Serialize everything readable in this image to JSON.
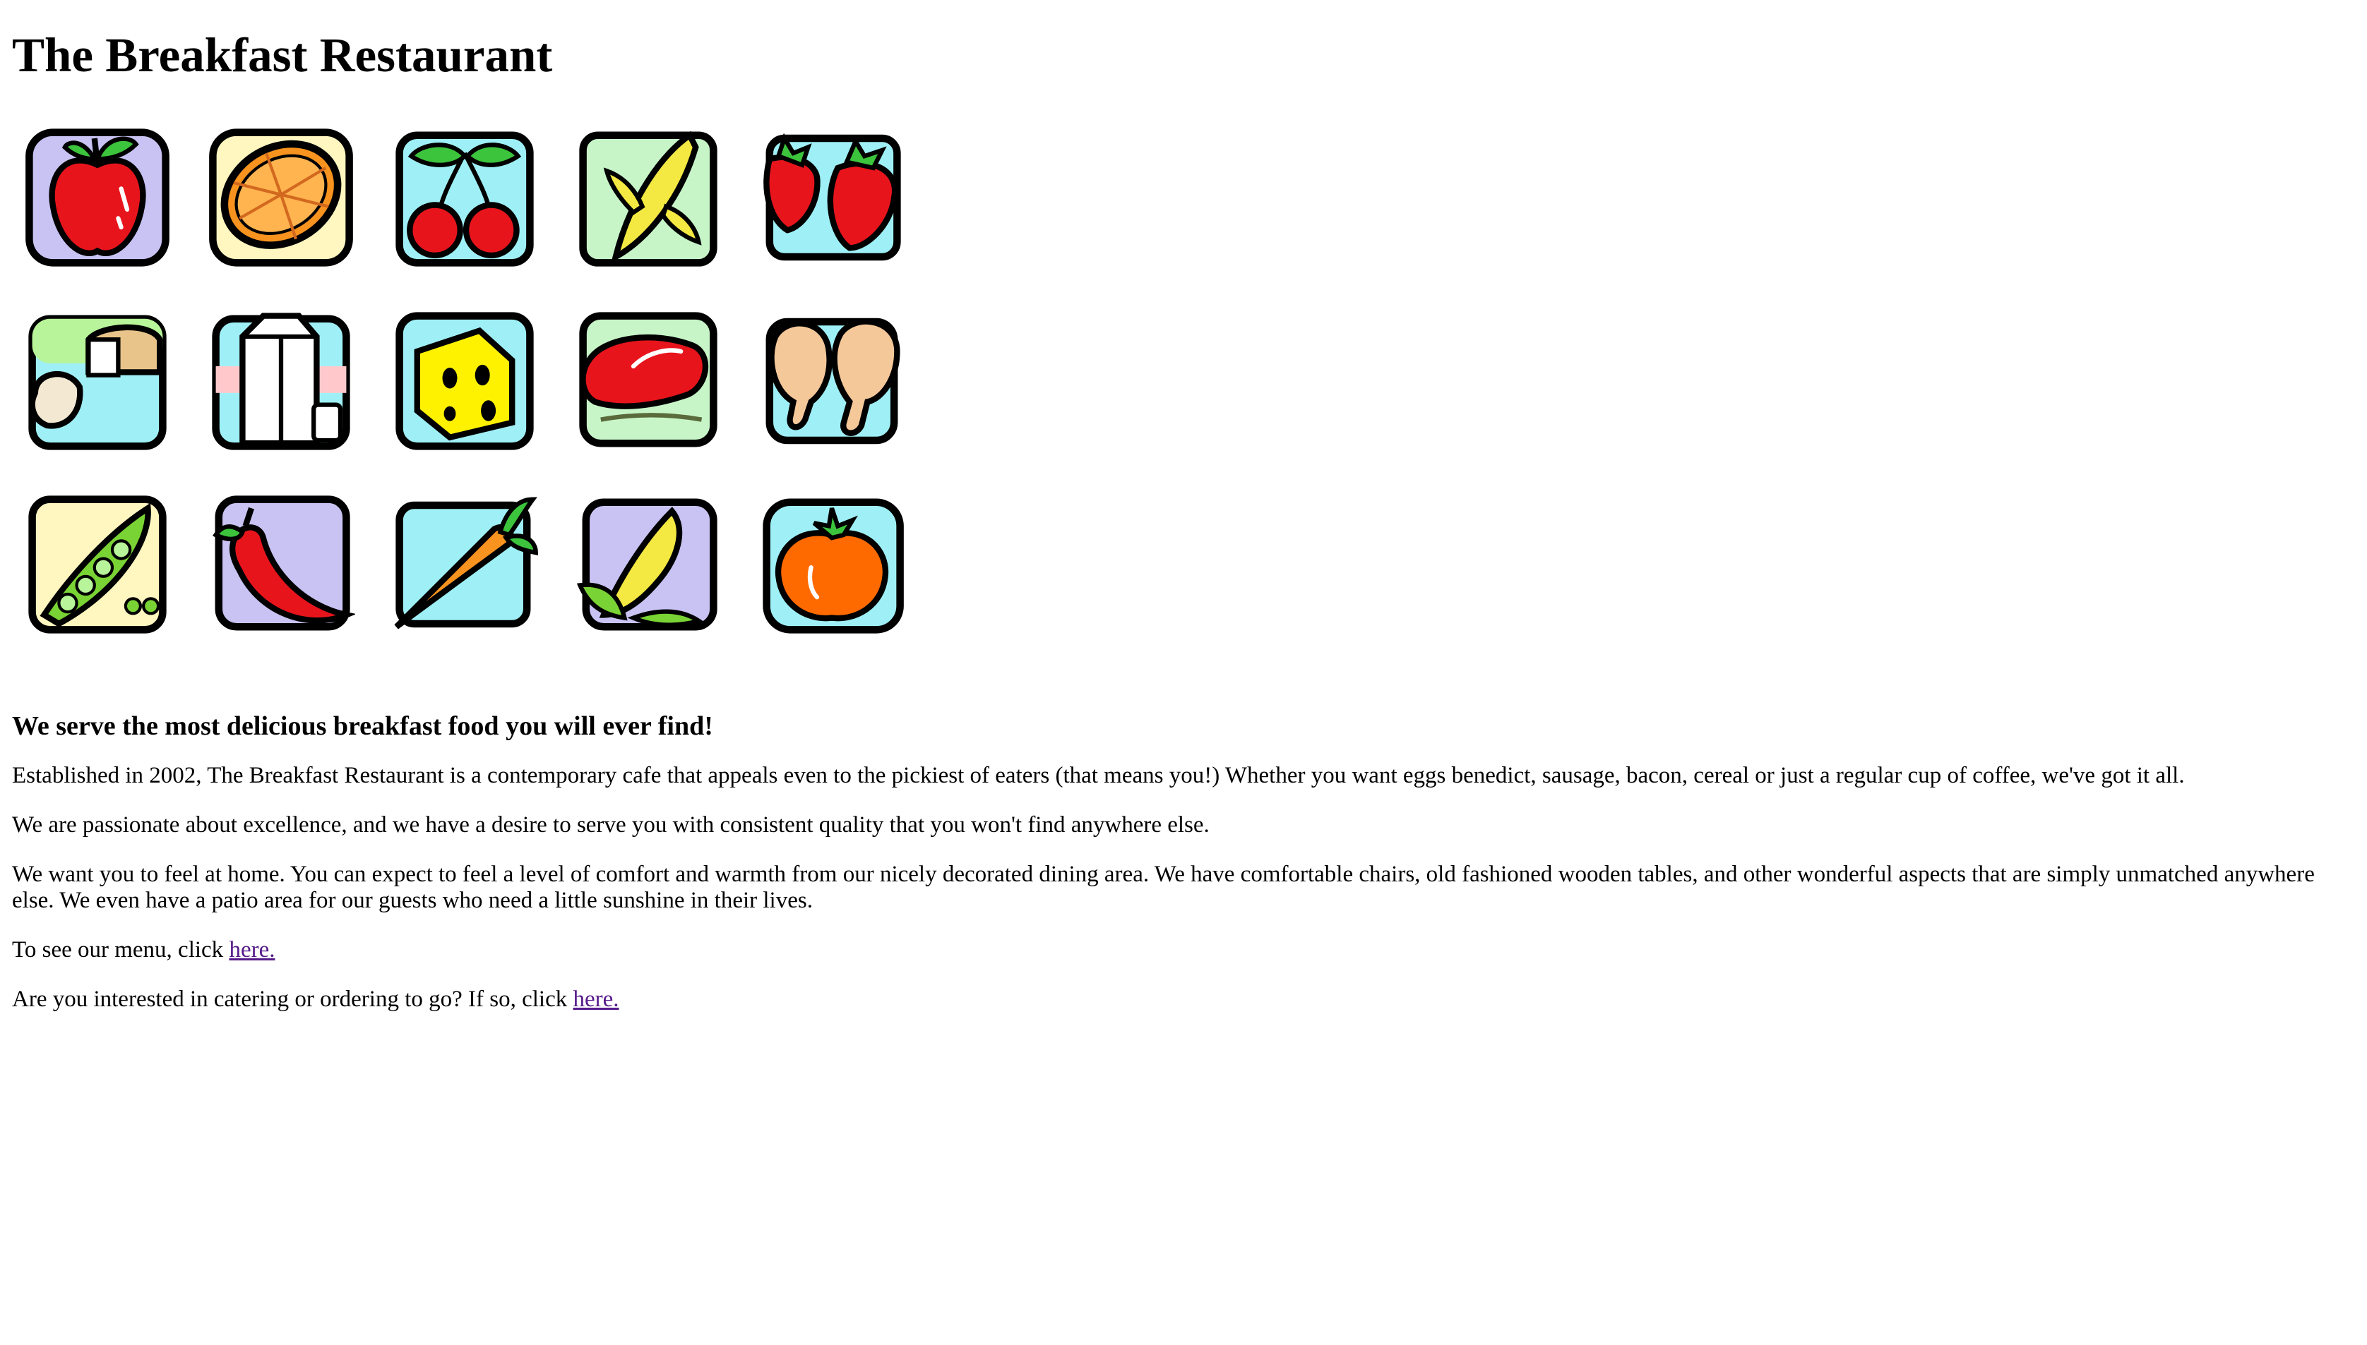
{
  "page": {
    "title": "The Breakfast Restaurant"
  },
  "food_icons": [
    {
      "icon": "apple-icon",
      "bg": "#c8c3f3",
      "color": "#e8141c"
    },
    {
      "icon": "orange-slice-icon",
      "bg": "#fff6c0",
      "color": "#f7931e"
    },
    {
      "icon": "cherries-icon",
      "bg": "#9ff0f6",
      "color": "#e8141c"
    },
    {
      "icon": "banana-icon",
      "bg": "#c7f5c8",
      "color": "#f4e842"
    },
    {
      "icon": "strawberries-icon",
      "bg": "#9ff0f6",
      "color": "#e8141c"
    },
    {
      "icon": "bread-icon",
      "bg": "#b8f59a",
      "color": "#f3e8d2"
    },
    {
      "icon": "milk-carton-icon",
      "bg": "#c7f5c8",
      "color": "#ffffff"
    },
    {
      "icon": "cheese-icon",
      "bg": "#9ff0f6",
      "color": "#fff200"
    },
    {
      "icon": "steak-icon",
      "bg": "#c7f5c8",
      "color": "#e8141c"
    },
    {
      "icon": "chicken-legs-icon",
      "bg": "#9ff0f6",
      "color": "#f5c89a"
    },
    {
      "icon": "peas-icon",
      "bg": "#fff6c0",
      "color": "#7ad334"
    },
    {
      "icon": "chili-pepper-icon",
      "bg": "#c8c3f3",
      "color": "#e8141c"
    },
    {
      "icon": "carrot-icon",
      "bg": "#9ff0f6",
      "color": "#f7931e"
    },
    {
      "icon": "corn-icon",
      "bg": "#c8c3f3",
      "color": "#f4e842"
    },
    {
      "icon": "tomato-icon",
      "bg": "#9ff0f6",
      "color": "#ff6a00"
    }
  ],
  "content": {
    "heading": "We serve the most delicious breakfast food you will ever find!",
    "para1": "Established in 2002, The Breakfast Restaurant is a contemporary cafe that appeals even to the pickiest of eaters (that means you!) Whether you want eggs benedict, sausage, bacon, cereal or just a regular cup of coffee, we've got it all.",
    "para2": "We are passionate about excellence, and we have a desire to serve you with consistent quality that you won't find anywhere else.",
    "para3": "We want you to feel at home. You can expect to feel a level of comfort and warmth from our nicely decorated dining area. We have comfortable chairs, old fashioned wooden tables, and other wonderful aspects that are simply unmatched anywhere else. We even have a patio area for our guests who need a little sunshine in their lives.",
    "menu_text": "To see our menu, click ",
    "menu_link": "here.",
    "catering_text": "Are you interested in catering or ordering to go? If so, click ",
    "catering_link": "here."
  },
  "colors": {
    "link": "#551a8b",
    "text": "#000000",
    "background": "#ffffff"
  }
}
